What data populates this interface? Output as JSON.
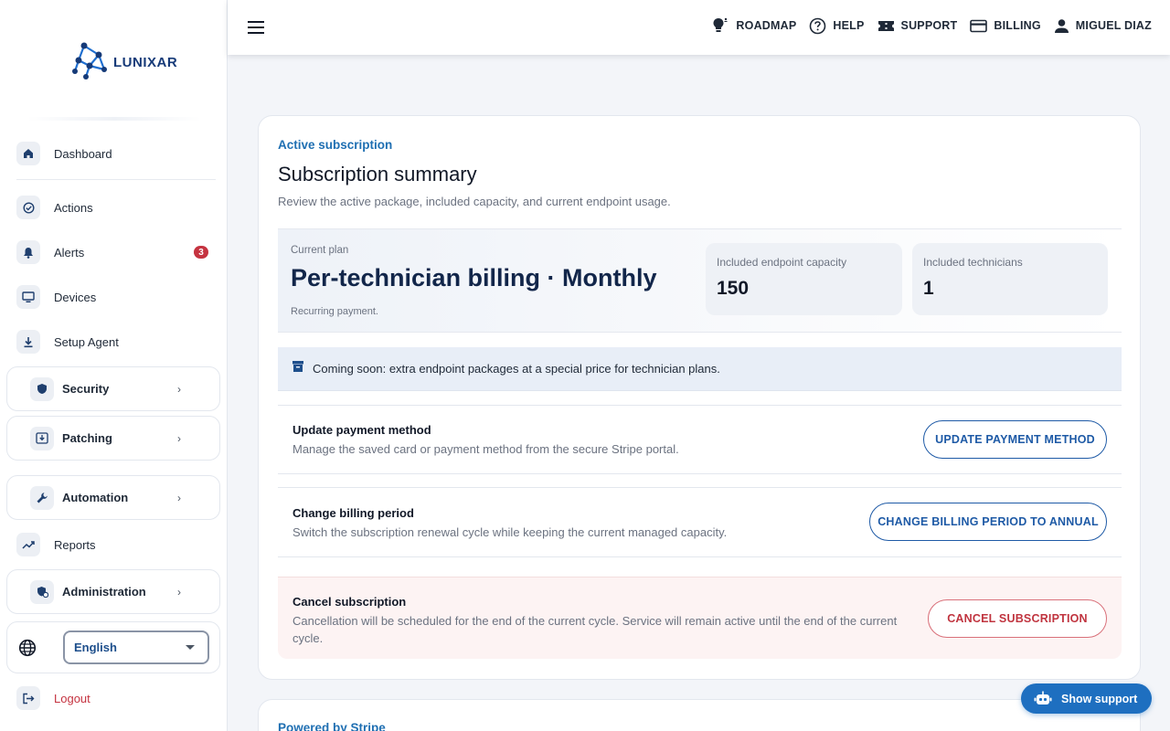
{
  "brand": {
    "name": "LUNIXAR"
  },
  "sidebar": {
    "items": [
      {
        "label": "Dashboard",
        "icon": "home-icon"
      },
      {
        "label": "Actions",
        "icon": "check-circle-icon"
      },
      {
        "label": "Alerts",
        "icon": "bell-icon",
        "badge": "3"
      },
      {
        "label": "Devices",
        "icon": "monitor-icon"
      },
      {
        "label": "Setup Agent",
        "icon": "download-icon"
      }
    ],
    "groups": [
      {
        "label": "Security",
        "icon": "shield-icon"
      },
      {
        "label": "Patching",
        "icon": "patch-download-icon"
      },
      {
        "label": "Automation",
        "icon": "wrench-icon"
      },
      {
        "label": "Administration",
        "icon": "admin-shield-icon"
      }
    ],
    "reports_label": "Reports",
    "language": "English",
    "logout_label": "Logout"
  },
  "topbar": {
    "roadmap": "ROADMAP",
    "help": "HELP",
    "support": "SUPPORT",
    "billing": "BILLING",
    "user": "MIGUEL DIAZ"
  },
  "subscription": {
    "overline": "Active subscription",
    "title": "Subscription summary",
    "subtitle": "Review the active package, included capacity, and current endpoint usage.",
    "plan_label": "Current plan",
    "plan_name": "Per-technician billing · Monthly",
    "plan_note": "Recurring payment.",
    "capacity_label": "Included endpoint capacity",
    "capacity_value": "150",
    "technicians_label": "Included technicians",
    "technicians_value": "1",
    "notice": "Coming soon: extra endpoint packages at a special price for technician plans."
  },
  "actions": {
    "payment": {
      "title": "Update payment method",
      "desc": "Manage the saved card or payment method from the secure Stripe portal.",
      "button": "UPDATE PAYMENT METHOD"
    },
    "period": {
      "title": "Change billing period",
      "desc": "Switch the subscription renewal cycle while keeping the current managed capacity.",
      "button": "CHANGE BILLING PERIOD TO ANNUAL"
    },
    "cancel": {
      "title": "Cancel subscription",
      "desc": "Cancellation will be scheduled for the end of the current cycle. Service will remain active until the end of the current cycle.",
      "button": "CANCEL SUBSCRIPTION"
    }
  },
  "stripe": {
    "title": "Powered by Stripe"
  },
  "support_widget": {
    "label": "Show support"
  },
  "colors": {
    "accent": "#1e6fc0",
    "danger": "#c53340",
    "navy": "#12264a"
  }
}
